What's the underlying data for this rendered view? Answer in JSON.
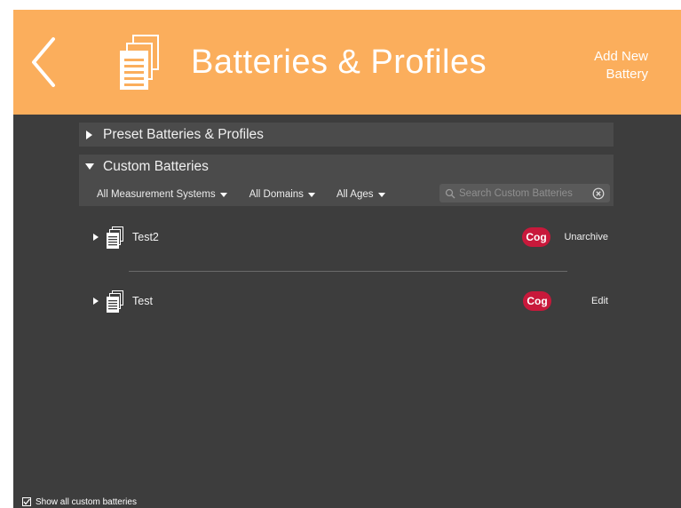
{
  "header": {
    "back_icon": "chevron-left-icon",
    "title_icon": "documents-stack-icon",
    "title": "Batteries & Profiles",
    "add_new_line1": "Add New",
    "add_new_line2": "Battery",
    "background_color": "#fbae5c"
  },
  "sections": {
    "preset": {
      "label": "Preset Batteries & Profiles",
      "expanded": false
    },
    "custom": {
      "label": "Custom Batteries",
      "expanded": true
    }
  },
  "filters": {
    "measurement": "All Measurement Systems",
    "domains": "All Domains",
    "ages": "All Ages"
  },
  "search": {
    "placeholder": "Search Custom Batteries",
    "value": ""
  },
  "batteries": [
    {
      "name": "Test2",
      "badge": "Cog",
      "action": "Unarchive"
    },
    {
      "name": "Test",
      "badge": "Cog",
      "action": "Edit"
    }
  ],
  "footer": {
    "checkbox_label": "Show all custom batteries",
    "checked": true
  },
  "colors": {
    "panel": "#3d3d3d",
    "section_bar": "#4b4b4b",
    "badge": "#c8193b"
  }
}
